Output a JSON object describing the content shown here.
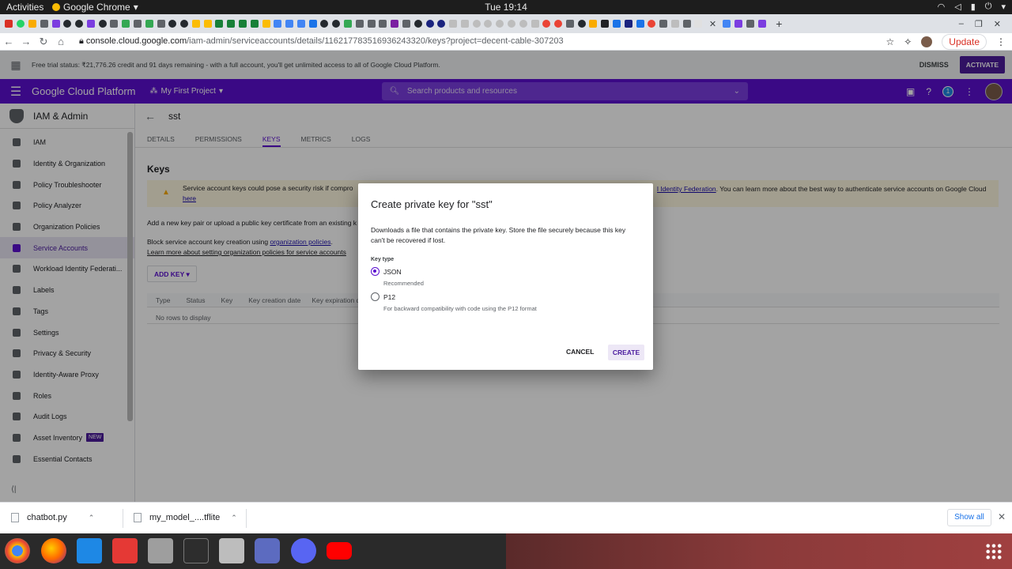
{
  "os": {
    "activities": "Activities",
    "app": "Google Chrome",
    "clock": "Tue 19:14"
  },
  "browser": {
    "url_host": "console.cloud.google.com",
    "url_path": "/iam-admin/serviceaccounts/details/116217783516936243320/keys?project=decent-cable-307203",
    "update": "Update"
  },
  "trial": {
    "text": "Free trial status: ₹21,776.26 credit and 91 days remaining - with a full account, you'll get unlimited access to all of Google Cloud Platform.",
    "dismiss": "DISMISS",
    "activate": "ACTIVATE"
  },
  "gcp": {
    "title": "Google Cloud Platform",
    "project": "My First Project",
    "search_placeholder": "Search products and resources",
    "notif": "1"
  },
  "sidebar": {
    "title": "IAM & Admin",
    "items": [
      {
        "label": "IAM"
      },
      {
        "label": "Identity & Organization"
      },
      {
        "label": "Policy Troubleshooter"
      },
      {
        "label": "Policy Analyzer"
      },
      {
        "label": "Organization Policies"
      },
      {
        "label": "Service Accounts"
      },
      {
        "label": "Workload Identity Federati..."
      },
      {
        "label": "Labels"
      },
      {
        "label": "Tags"
      },
      {
        "label": "Settings"
      },
      {
        "label": "Privacy & Security"
      },
      {
        "label": "Identity-Aware Proxy"
      },
      {
        "label": "Roles"
      },
      {
        "label": "Audit Logs"
      },
      {
        "label": "Asset Inventory",
        "badge": "NEW"
      },
      {
        "label": "Essential Contacts"
      }
    ]
  },
  "page": {
    "title": "sst",
    "tabs": [
      "DETAILS",
      "PERMISSIONS",
      "KEYS",
      "METRICS",
      "LOGS"
    ],
    "heading": "Keys",
    "warning_start": "Service account keys could pose a security risk if compro",
    "warning_link": "l Identity Federation",
    "warning_end": ". You can learn more about the best way to authenticate service accounts on Google Cloud",
    "warning_here": "here",
    "add_text": "Add a new key pair or upload a public key certificate from an existing k",
    "block_text": "Block service account key creation using ",
    "block_link": "organization policies",
    "learn_link": "Learn more about setting organization policies for service accounts",
    "add_key": "ADD KEY",
    "columns": [
      "Type",
      "Status",
      "Key",
      "Key creation date",
      "Key expiration d"
    ],
    "empty": "No rows to display"
  },
  "dialog": {
    "title": "Create private key for \"sst\"",
    "desc": "Downloads a file that contains the private key. Store the file securely because this key can't be recovered if lost.",
    "key_type": "Key type",
    "opt1": "JSON",
    "opt1_sub": "Recommended",
    "opt2": "P12",
    "opt2_sub": "For backward compatibility with code using the P12 format",
    "cancel": "CANCEL",
    "create": "CREATE"
  },
  "downloads": {
    "file1": "chatbot.py",
    "file2": "my_model_....tflite",
    "show_all": "Show all"
  },
  "colors": {
    "accent": "#5b0fd0"
  }
}
